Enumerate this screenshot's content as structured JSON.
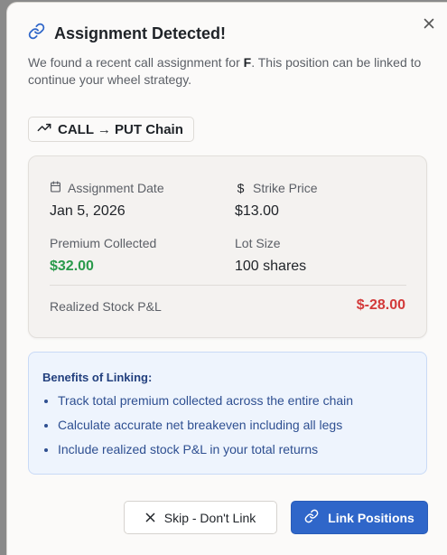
{
  "dialog": {
    "title": "Assignment Detected!",
    "description_pre": "We found a recent call assignment for ",
    "ticker": "F",
    "description_post": ". This position can be linked to continue your wheel strategy.",
    "close_icon": "close-icon",
    "title_icon": "link-icon"
  },
  "chain_badge": {
    "icon": "trending-up-icon",
    "label": "CALL → PUT Chain"
  },
  "details": {
    "assignment_date_label": "Assignment Date",
    "assignment_date_value": "Jan 5, 2026",
    "strike_price_label": "Strike Price",
    "strike_price_value": "$13.00",
    "premium_label": "Premium Collected",
    "premium_value": "$32.00",
    "lot_size_label": "Lot Size",
    "lot_size_value": "100 shares",
    "realized_pl_label": "Realized Stock P&L",
    "realized_pl_value": "$-28.00"
  },
  "benefits": {
    "title": "Benefits of Linking:",
    "items": [
      "Track total premium collected across the entire chain",
      "Calculate accurate net breakeven including all legs",
      "Include realized stock P&L in your total returns"
    ]
  },
  "buttons": {
    "skip_label": "Skip - Don't Link",
    "link_label": "Link Positions"
  },
  "colors": {
    "accent": "#2f66c9",
    "positive": "#2a9a4b",
    "negative": "#d33a3a",
    "benefits_bg": "#eef4fd"
  }
}
